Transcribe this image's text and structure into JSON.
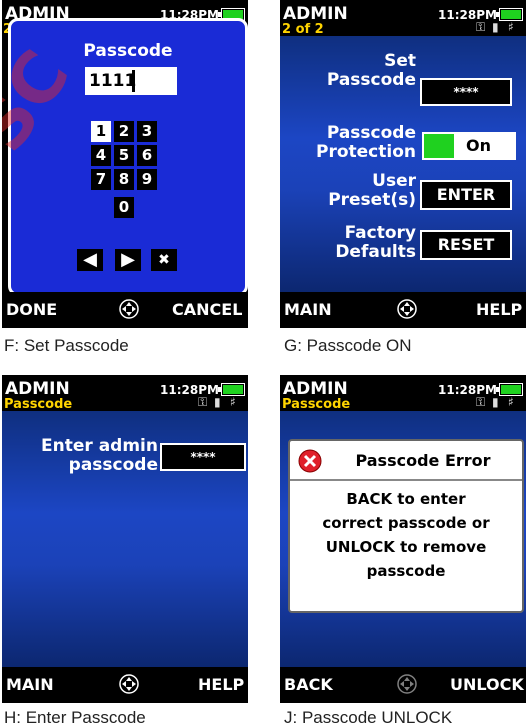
{
  "header": {
    "title": "ADMIN",
    "clock": "11:28PM"
  },
  "panels": {
    "f": {
      "caption": "F: Set Passcode",
      "page_indicator": "2",
      "dialog_title": "Passcode",
      "entry_value": "1111",
      "keys": [
        "1",
        "2",
        "3",
        "4",
        "5",
        "6",
        "7",
        "8",
        "9",
        "0"
      ],
      "selected_key": "1",
      "footer": {
        "left": "DONE",
        "right": "CANCEL"
      }
    },
    "g": {
      "caption": "G: Passcode ON",
      "subtitle": "2 of 2",
      "rows": {
        "set_label": "Set\nPasscode",
        "set_value": "****",
        "prot_label": "Passcode\nProtection",
        "prot_value": "On",
        "preset_label": "User\nPreset(s)",
        "preset_value": "ENTER",
        "factory_label": "Factory\nDefaults",
        "factory_value": "RESET"
      },
      "footer": {
        "left": "MAIN",
        "right": "HELP"
      }
    },
    "h": {
      "caption": "H: Enter Passcode",
      "subtitle": "Passcode",
      "prompt": "Enter admin\npasscode",
      "field_value": "****",
      "footer": {
        "left": "MAIN",
        "right": "HELP"
      }
    },
    "j": {
      "caption": "J: Passcode UNLOCK",
      "subtitle": "Passcode",
      "error_title": "Passcode Error",
      "error_message": "BACK to enter\ncorrect passcode or\nUNLOCK to remove\npasscode",
      "footer": {
        "left": "BACK",
        "right": "UNLOCK"
      }
    }
  },
  "icons": {
    "accent_green": "#1fd11f",
    "subtitle_yellow": "#ffd400",
    "error_red": "#e0202a"
  }
}
